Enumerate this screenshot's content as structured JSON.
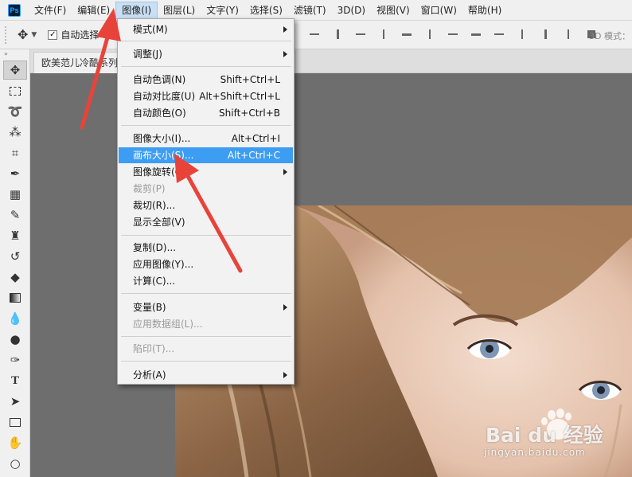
{
  "menubar": {
    "logo": "Ps",
    "items": [
      "文件(F)",
      "编辑(E)",
      "图像(I)",
      "图层(L)",
      "文字(Y)",
      "选择(S)",
      "滤镜(T)",
      "3D(D)",
      "视图(V)",
      "窗口(W)",
      "帮助(H)"
    ],
    "active_index": 2
  },
  "options": {
    "auto_select_label": "自动选择",
    "auto_select_checked": true,
    "mode_3d_label": "3D 模式："
  },
  "document": {
    "tab_title": "欧美范儿冷酷系列"
  },
  "image_menu": {
    "items": [
      {
        "label": "模式(M)",
        "submenu": true
      },
      {
        "label": "调整(J)",
        "submenu": true
      },
      {
        "label": "自动色调(N)",
        "shortcut": "Shift+Ctrl+L"
      },
      {
        "label": "自动对比度(U)",
        "shortcut": "Alt+Shift+Ctrl+L"
      },
      {
        "label": "自动颜色(O)",
        "shortcut": "Shift+Ctrl+B"
      },
      {
        "label": "图像大小(I)...",
        "shortcut": "Alt+Ctrl+I"
      },
      {
        "label": "画布大小(S)...",
        "shortcut": "Alt+Ctrl+C",
        "highlighted": true
      },
      {
        "label": "图像旋转(G)",
        "submenu": true
      },
      {
        "label": "裁剪(P)",
        "disabled": true
      },
      {
        "label": "裁切(R)..."
      },
      {
        "label": "显示全部(V)"
      },
      {
        "label": "复制(D)..."
      },
      {
        "label": "应用图像(Y)..."
      },
      {
        "label": "计算(C)..."
      },
      {
        "label": "变量(B)",
        "submenu": true
      },
      {
        "label": "应用数据组(L)...",
        "disabled": true
      },
      {
        "label": "陷印(T)...",
        "disabled": true
      },
      {
        "label": "分析(A)",
        "submenu": true
      }
    ]
  },
  "toolbar": {
    "tools": [
      "move-tool",
      "marquee-tool",
      "lasso-tool",
      "magic-wand-tool",
      "crop-tool",
      "eyedropper-tool",
      "healing-brush-tool",
      "brush-tool",
      "clone-stamp-tool",
      "history-brush-tool",
      "eraser-tool",
      "gradient-tool",
      "blur-tool",
      "dodge-tool",
      "pen-tool",
      "type-tool",
      "path-selection-tool",
      "rectangle-tool",
      "hand-tool",
      "zoom-tool"
    ]
  },
  "watermark": {
    "brand": "Bai du 经验",
    "url": "jingyan.baidu.com"
  },
  "colors": {
    "menu_highlight": "#3d9df2",
    "arrow": "#e8433b",
    "canvas_bg": "#6e6e6e"
  }
}
